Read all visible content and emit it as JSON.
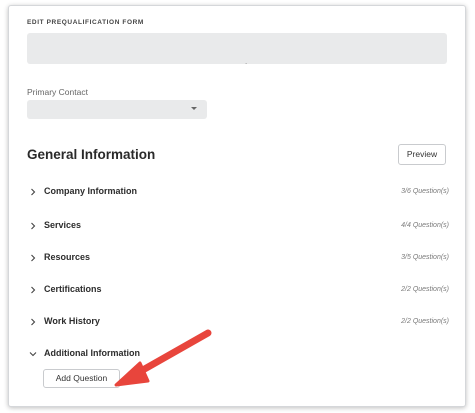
{
  "form": {
    "title": "EDIT PREQUALIFICATION FORM",
    "name_value": ".",
    "primary_contact_label": "Primary Contact",
    "primary_contact_value": ""
  },
  "section": {
    "title": "General Information",
    "preview_label": "Preview"
  },
  "accordion": [
    {
      "label": "Company Information",
      "count": "3/6 Question(s)",
      "expanded": false
    },
    {
      "label": "Services",
      "count": "4/4 Question(s)",
      "expanded": false
    },
    {
      "label": "Resources",
      "count": "3/5 Question(s)",
      "expanded": false
    },
    {
      "label": "Certifications",
      "count": "2/2 Question(s)",
      "expanded": false
    },
    {
      "label": "Work History",
      "count": "2/2 Question(s)",
      "expanded": false
    },
    {
      "label": "Additional Information",
      "count": "",
      "expanded": true
    }
  ],
  "add_question_label": "Add Question",
  "colors": {
    "annotation_arrow": "#e8453c",
    "field_bg": "#e9eaeb"
  },
  "icons": {
    "collapsed": "chevron-right-icon",
    "expanded": "chevron-down-icon",
    "select": "caret-down-icon"
  }
}
